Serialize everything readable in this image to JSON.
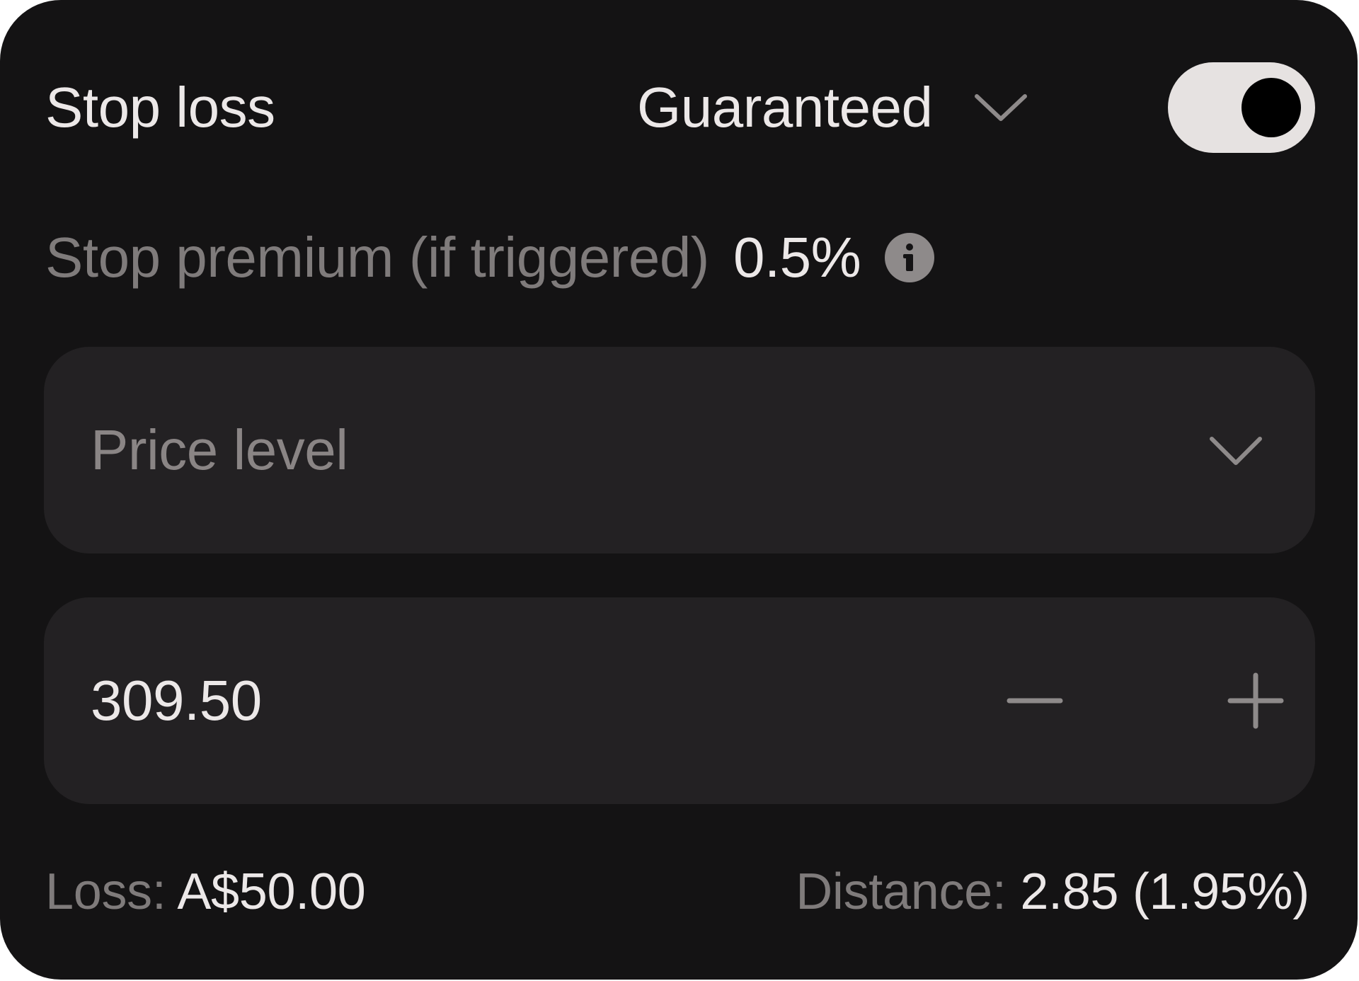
{
  "stop_loss": {
    "title": "Stop loss",
    "type_selected": "Guaranteed",
    "enabled": true
  },
  "premium": {
    "label": "Stop premium (if triggered)",
    "value": "0.5%"
  },
  "mode_select": {
    "placeholder": "Price level"
  },
  "price_input": {
    "value": "309.50"
  },
  "summary": {
    "loss_label": "Loss:",
    "loss_value": "A$50.00",
    "distance_label": "Distance:",
    "distance_value": "2.85 (1.95%)"
  },
  "icons": {
    "type_dropdown": "chevron-down-icon",
    "info": "info-icon",
    "mode_dropdown": "chevron-down-icon",
    "decrement": "minus-icon",
    "increment": "plus-icon"
  },
  "colors": {
    "panel_bg": "#141314",
    "field_bg": "#232123",
    "text_primary": "#ece8e8",
    "text_muted": "#7f7b7b",
    "toggle_track": "#e6e2e1",
    "toggle_knob": "#000000"
  }
}
